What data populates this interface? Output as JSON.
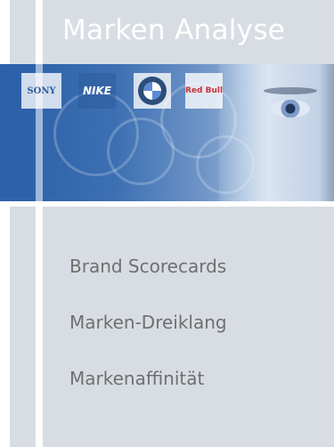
{
  "header": {
    "title": "Marken Analyse"
  },
  "banner": {
    "logos": {
      "sony": "SONY",
      "nike": "NIKE",
      "bmw": "BMW",
      "redbull": "Red Bull"
    }
  },
  "menu": {
    "items": [
      {
        "label": "Brand Scorecards"
      },
      {
        "label": "Marken-Dreiklang"
      },
      {
        "label": "Markenaffinität"
      }
    ]
  },
  "colors": {
    "panel": "#d8dde4",
    "banner_blue": "#2d62ab",
    "title_text": "#ffffff",
    "menu_text": "#6f6f6f"
  }
}
